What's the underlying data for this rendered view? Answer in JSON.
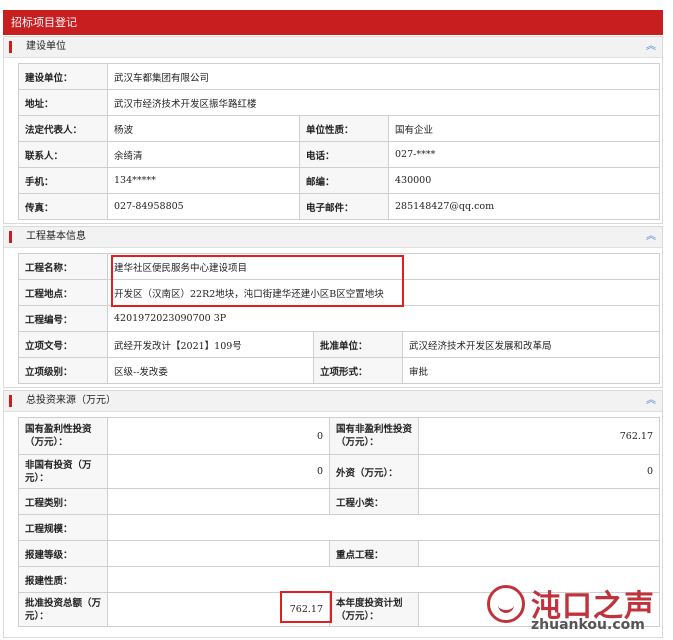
{
  "title": "招标项目登记",
  "sections": {
    "builder": {
      "heading": "建设单位",
      "rows": {
        "unit_label": "建设单位：",
        "unit_value": "武汉车都集团有限公司",
        "addr_label": "地址：",
        "addr_value": "武汉市经济技术开发区振华路红楼",
        "legal_label": "法定代表人：",
        "legal_value": "杨波",
        "nature_label": "单位性质：",
        "nature_value": "国有企业",
        "contact_label": "联系人：",
        "contact_value": "余绮清",
        "phone_label": "电话：",
        "phone_value": "027-****",
        "mobile_label": "手机：",
        "mobile_value": "134*****",
        "zip_label": "邮编：",
        "zip_value": "430000",
        "fax_label": "传真：",
        "fax_value": "027-84958805",
        "email_label": "电子邮件：",
        "email_value": "285148427@qq.com"
      }
    },
    "project": {
      "heading": "工程基本信息",
      "rows": {
        "name_label": "工程名称：",
        "name_value": "建华社区便民服务中心建设项目",
        "site_label": "工程地点：",
        "site_value": "开发区（汉南区）22R2地块，沌口街建华还建小区B区空置地块",
        "code_label": "工程编号：",
        "code_value": "4201972023090700 3P",
        "approval_doc_label": "立项文号：",
        "approval_doc_value": "武经开发改计【2021】109号",
        "approver_label": "批准单位：",
        "approver_value": "武汉经济技术开发区发展和改革局",
        "level_label": "立项级别：",
        "level_value": "区级--发改委",
        "form_label": "立项形式：",
        "form_value": "审批"
      }
    },
    "funding": {
      "heading": "总投资来源（万元）",
      "rows": {
        "state_profit_label": "国有盈利性投资（万元）：",
        "state_profit_value": "0",
        "state_nonprofit_label": "国有非盈利性投资（万元）：",
        "state_nonprofit_value": "762.17",
        "nonstate_label": "非国有投资（万元）：",
        "nonstate_value": "0",
        "foreign_label": "外资（万元）：",
        "foreign_value": "0",
        "category_label": "工程类别：",
        "category_value": "",
        "subcategory_label": "工程小类：",
        "subcategory_value": "",
        "scale_label": "工程规模：",
        "scale_value": "",
        "grade_label": "报建等级：",
        "grade_value": "",
        "key_label": "重点工程：",
        "key_value": "",
        "nature_label": "报建性质：",
        "nature_value": "",
        "total_label": "批准投资总额（万元）：",
        "total_value": "762.17",
        "annual_label": "本年度投资计划（万元）：",
        "annual_value": ""
      }
    }
  },
  "watermark": {
    "brand": "沌口之声",
    "url": "zhuankou.com"
  },
  "colors": {
    "accent": "#c81e20",
    "chevron": "#4a8bd6",
    "highlight": "#e02020"
  },
  "icons": {
    "collapse": "chevron-up-icon"
  }
}
